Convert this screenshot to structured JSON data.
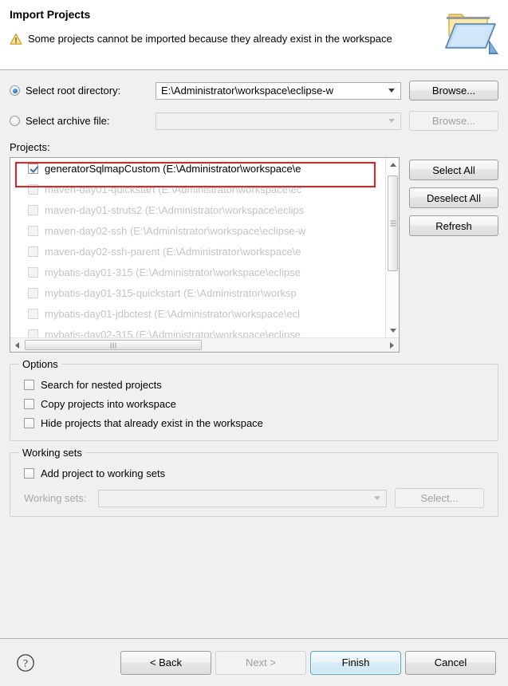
{
  "header": {
    "title": "Import Projects",
    "message": "Some projects cannot be imported because they already exist in the workspace",
    "warning_icon": "warning-triangle-icon",
    "banner_icon": "open-folder-icon"
  },
  "source": {
    "root_directory": {
      "label": "Select root directory:",
      "value": "E:\\Administrator\\workspace\\eclipse-w",
      "selected": true,
      "browse_label": "Browse..."
    },
    "archive_file": {
      "label": "Select archive file:",
      "value": "",
      "selected": false,
      "browse_label": "Browse..."
    }
  },
  "projects": {
    "label": "Projects:",
    "items": [
      {
        "name": "generatorSqlmapCustom (E:\\Administrator\\workspace\\e",
        "checked": true,
        "disabled": false
      },
      {
        "name": "maven-day01-quickstart (E:\\Administrator\\workspace\\ec",
        "checked": false,
        "disabled": true
      },
      {
        "name": "maven-day01-struts2 (E:\\Administrator\\workspace\\eclips",
        "checked": false,
        "disabled": true
      },
      {
        "name": "maven-day02-ssh (E:\\Administrator\\workspace\\eclipse-w",
        "checked": false,
        "disabled": true
      },
      {
        "name": "maven-day02-ssh-parent (E:\\Administrator\\workspace\\e",
        "checked": false,
        "disabled": true
      },
      {
        "name": "mybatis-day01-315 (E:\\Administrator\\workspace\\eclipse",
        "checked": false,
        "disabled": true
      },
      {
        "name": "mybatis-day01-315-quickstart (E:\\Administrator\\worksp",
        "checked": false,
        "disabled": true
      },
      {
        "name": "mybatis-day01-jdbctest (E:\\Administrator\\workspace\\ecl",
        "checked": false,
        "disabled": true
      },
      {
        "name": "mybatis-day02-315 (E:\\Administrator\\workspace\\eclipse",
        "checked": false,
        "disabled": true
      }
    ],
    "buttons": {
      "select_all": "Select All",
      "deselect_all": "Deselect All",
      "refresh": "Refresh"
    },
    "highlight_color": "#e8201f"
  },
  "options": {
    "title": "Options",
    "items": [
      {
        "label": "Search for nested projects",
        "checked": false
      },
      {
        "label": "Copy projects into workspace",
        "checked": false
      },
      {
        "label": "Hide projects that already exist in the workspace",
        "checked": false
      }
    ]
  },
  "working_sets": {
    "title": "Working sets",
    "add_checkbox": {
      "label": "Add project to working sets",
      "checked": false
    },
    "combo_label": "Working sets:",
    "combo_value": "",
    "select_label": "Select..."
  },
  "footer": {
    "help_icon": "help-question-icon",
    "back": "< Back",
    "next": "Next >",
    "finish": "Finish",
    "cancel": "Cancel",
    "default_button": "Finish"
  }
}
